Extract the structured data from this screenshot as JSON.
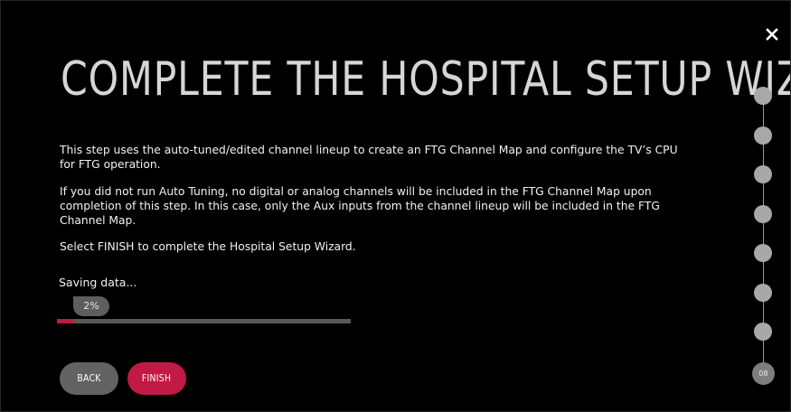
{
  "wizard": {
    "title": "COMPLETE THE HOSPITAL SETUP WIZARD",
    "paragraphs": [
      "This step uses the auto-tuned/edited channel lineup to create an FTG Channel Map and configure the TV’s CPU for FTG operation.",
      "If you did not run Auto Tuning, no digital or analog channels will be included in the FTG Channel Map upon completion of this step. In this case, only the Aux inputs from the channel lineup will be included in the FTG Channel Map.",
      "Select FINISH to complete the Hospital Setup Wizard."
    ]
  },
  "progress": {
    "status_text": "Saving data...",
    "percent_label": "2%",
    "percent_value": 0.055
  },
  "buttons": {
    "back_label": "BACK",
    "finish_label": "FINISH"
  },
  "steps": {
    "total": 8,
    "current_label": "08"
  },
  "icons": {
    "close": "close-icon"
  },
  "colors": {
    "accent": "#c11a44",
    "background": "#000000",
    "button_secondary": "#626262",
    "step_dot": "#a8a8a8"
  }
}
